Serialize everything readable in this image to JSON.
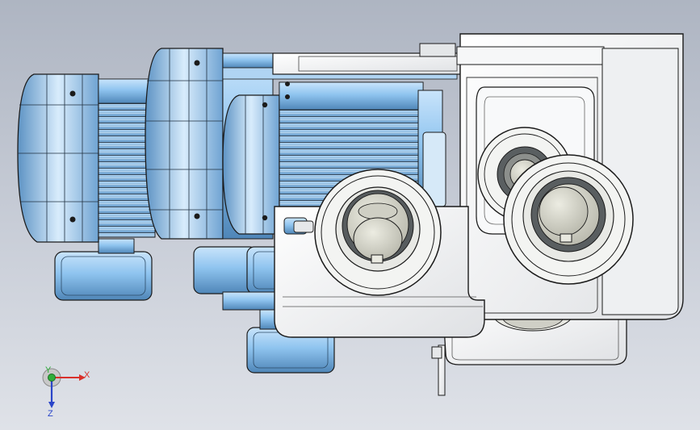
{
  "viewport": {
    "background_top": "#aeb5c2",
    "background_bottom": "#dfe2e8"
  },
  "model": {
    "motor_color": "#8fc4ef",
    "housing_color": "#f4f5f6",
    "roller_color": "#d8d8cc",
    "outline_color": "#1b1b1b"
  },
  "triad": {
    "x_label": "X",
    "y_label": "Y",
    "z_label": "Z",
    "x_color": "#d9302a",
    "y_color": "#2fae3a",
    "z_color": "#2a45c9"
  }
}
